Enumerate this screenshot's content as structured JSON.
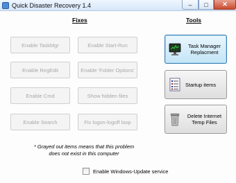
{
  "window": {
    "title": "Quick Disaster Recovery 1.4",
    "minimize_glyph": "–",
    "maximize_glyph": "□",
    "close_glyph": "✕"
  },
  "fixes": {
    "heading": "Fixes",
    "buttons": [
      {
        "label": "Enable TaskMgr",
        "enabled": false
      },
      {
        "label": "Enable Start-Run",
        "enabled": false
      },
      {
        "label": "Enable RegEdit",
        "enabled": false
      },
      {
        "label": "Enable 'Folder Options'",
        "enabled": false
      },
      {
        "label": "Enable Cmd",
        "enabled": false
      },
      {
        "label": "Show hidden files",
        "enabled": false
      },
      {
        "label": "Enable Search",
        "enabled": false
      },
      {
        "label": "Fix logon-logoff loop",
        "enabled": false
      }
    ]
  },
  "tools": {
    "heading": "Tools",
    "task_manager": {
      "label": "Task Manager Replacment",
      "icon": "monitor-icon"
    },
    "startup": {
      "label": "Startup items",
      "icon": "list-document-icon"
    },
    "delete_temp": {
      "label": "Delete Internet Temp Files",
      "icon": "trash-can-icon"
    }
  },
  "note": "* Grayed out items means that this problem does not exist in this computer",
  "windows_update": {
    "label": "Enable Windows-Update service",
    "checked": false
  },
  "colors": {
    "disabled_text": "#a8a8a8",
    "focused_border": "#3c7fb1",
    "close_button": "#c9492f"
  }
}
